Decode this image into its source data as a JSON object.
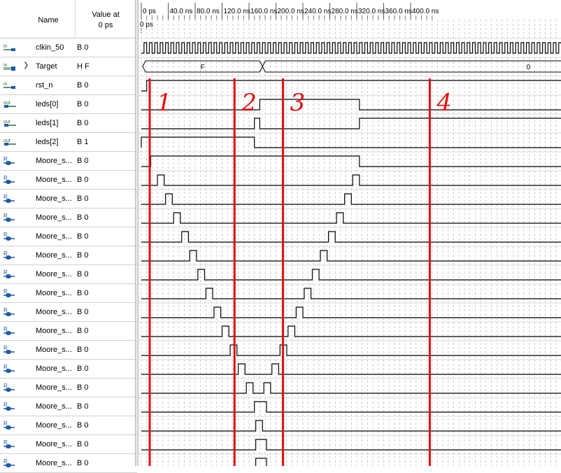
{
  "header": {
    "name_label": "Name",
    "value_label_line1": "Value at",
    "value_label_line2": "0 ps"
  },
  "cursor_label": "0 ps",
  "time_ticks": [
    "0 ps",
    "40.0 ns",
    "80.0 ns",
    "120.0 ns",
    "160.0 ns",
    "200.0 ns",
    "240.0 ns",
    "280.0 ns",
    "320.0 ns",
    "360.0 ns",
    "400.0 ns"
  ],
  "signals": [
    {
      "name": "clkin_50",
      "value": "B 0",
      "type": "in"
    },
    {
      "name": "Target",
      "value": "H F",
      "type": "in-bus",
      "expandable": true
    },
    {
      "name": "rst_n",
      "value": "B 0",
      "type": "in"
    },
    {
      "name": "leds[0]",
      "value": "B 0",
      "type": "out"
    },
    {
      "name": "leds[1]",
      "value": "B 0",
      "type": "out"
    },
    {
      "name": "leds[2]",
      "value": "B 1",
      "type": "out"
    },
    {
      "name": "Moore_s...",
      "value": "B 0",
      "type": "reg"
    },
    {
      "name": "Moore_s...",
      "value": "B 0",
      "type": "reg"
    },
    {
      "name": "Moore_s...",
      "value": "B 0",
      "type": "reg"
    },
    {
      "name": "Moore_s...",
      "value": "B 0",
      "type": "reg"
    },
    {
      "name": "Moore_s...",
      "value": "B 0",
      "type": "reg"
    },
    {
      "name": "Moore_s...",
      "value": "B 0",
      "type": "reg"
    },
    {
      "name": "Moore_s...",
      "value": "B 0",
      "type": "reg"
    },
    {
      "name": "Moore_s...",
      "value": "B 0",
      "type": "reg"
    },
    {
      "name": "Moore_s...",
      "value": "B 0",
      "type": "reg"
    },
    {
      "name": "Moore_s...",
      "value": "B 0",
      "type": "reg"
    },
    {
      "name": "Moore_s...",
      "value": "B 0",
      "type": "reg"
    },
    {
      "name": "Moore_s...",
      "value": "B 0",
      "type": "reg"
    },
    {
      "name": "Moore_s...",
      "value": "B 0",
      "type": "reg"
    },
    {
      "name": "Moore_s...",
      "value": "B 0",
      "type": "reg"
    },
    {
      "name": "Moore_s...",
      "value": "B 0",
      "type": "reg"
    },
    {
      "name": "Moore_s...",
      "value": "B 0",
      "type": "reg"
    },
    {
      "name": "Moore_s...",
      "value": "B 0",
      "type": "reg"
    }
  ],
  "bus_values": {
    "target_before": "F",
    "target_after": "0"
  },
  "waveform_times_ns": {
    "clock_period": 8,
    "target_change": 180,
    "rst_n_high": 8,
    "leds0_high": [
      176,
      324
    ],
    "leds1_high": [
      168,
      176,
      324,
      999
    ],
    "leds2_high": [
      0,
      168
    ],
    "state0_high": [
      14,
      324
    ],
    "state_pulse_width": 10,
    "state_rise_pulse_starts": [
      24,
      36,
      48,
      60,
      72,
      84,
      96,
      108,
      120,
      132,
      144,
      156,
      168,
      170,
      170,
      170
    ],
    "state_fall_pulse_starts": [
      314,
      302,
      290,
      278,
      266,
      254,
      242,
      230,
      218,
      206,
      194,
      182,
      176,
      170,
      176,
      176
    ]
  },
  "annotations": {
    "marker_labels": [
      "1",
      "2",
      "3",
      "4"
    ],
    "marker_times_ns": [
      0,
      126,
      198,
      416
    ],
    "marker_color": "#e01010"
  },
  "colors": {
    "grid": "#b4b4b4",
    "wave": "#000000",
    "icon_in": "#2a6e3a",
    "icon_out": "#2a6e3a",
    "icon_reg": "#1e5aa8"
  }
}
